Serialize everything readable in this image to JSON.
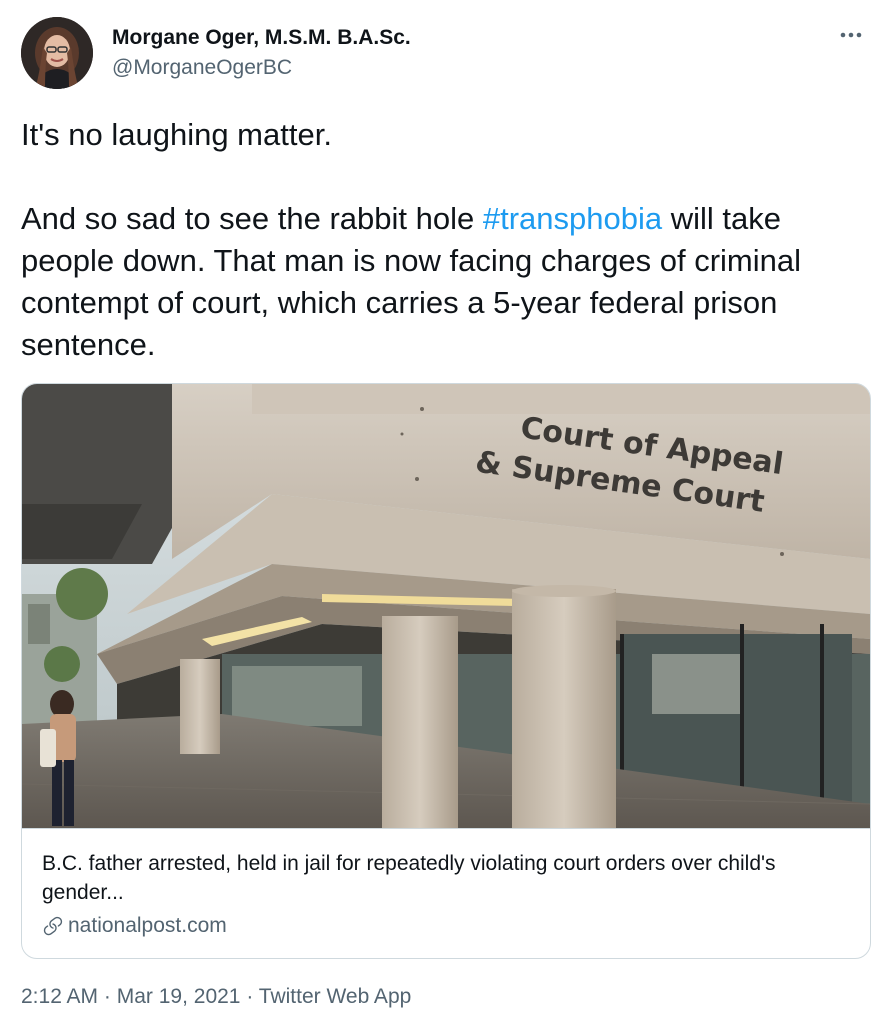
{
  "author": {
    "name": "Morgane Oger, M.S.M. B.A.Sc.",
    "handle": "@MorganeOgerBC"
  },
  "tweet": {
    "line1": "It's no laughing matter.",
    "para2_before": "And so sad to see the rabbit hole ",
    "hashtag": "#transphobia",
    "para2_after": " will take people down. That man is now facing charges of criminal contempt of court, which carries a 5-year federal prison sentence."
  },
  "card": {
    "sign_line1": "Court of Appeal",
    "sign_line2": "& Supreme Court",
    "title": "B.C. father arrested, held in jail for repeatedly violating court orders over child's gender...",
    "domain": "nationalpost.com"
  },
  "footer": {
    "time": "2:12 AM",
    "date": "Mar 19, 2021",
    "source": "Twitter Web App",
    "separator": " · "
  },
  "icons": {
    "more": "more-icon",
    "link": "link-icon"
  },
  "colors": {
    "text": "#0f1419",
    "secondary": "#536471",
    "accent": "#1d9bf0",
    "border": "#cfd9de"
  }
}
